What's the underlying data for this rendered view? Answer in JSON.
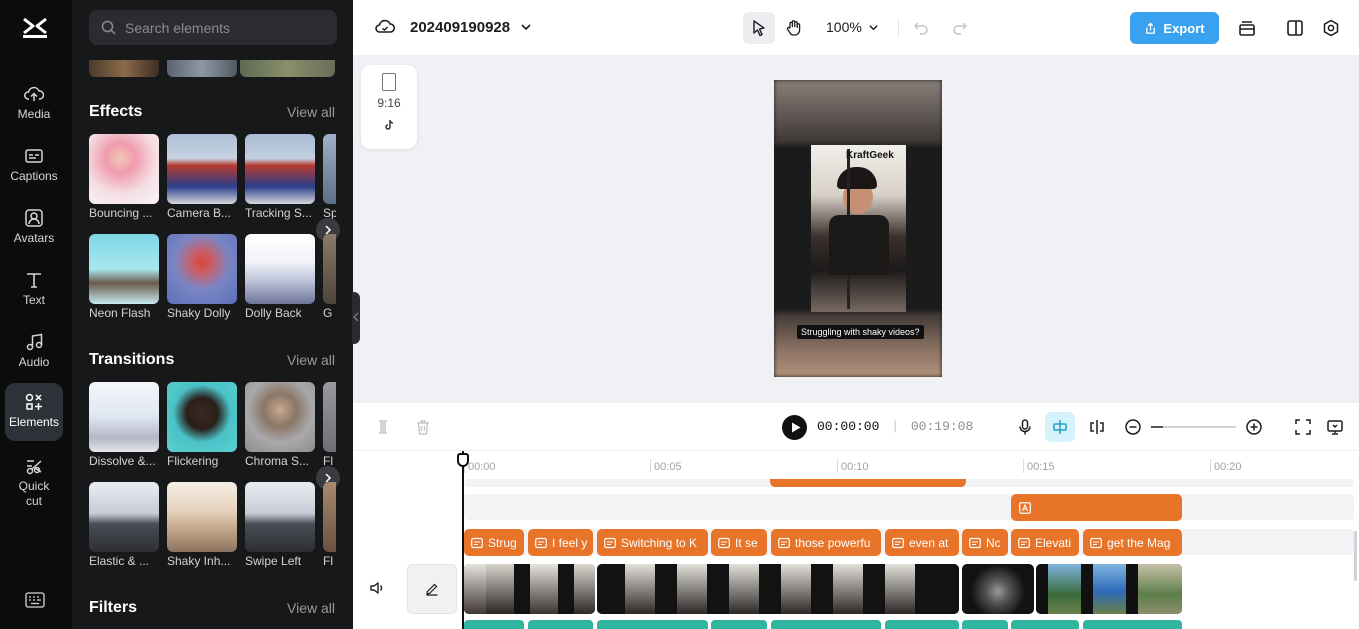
{
  "nav": {
    "items": [
      {
        "label": "Media",
        "icon": "cloud-upload-icon"
      },
      {
        "label": "Captions",
        "icon": "captions-icon"
      },
      {
        "label": "Avatars",
        "icon": "avatar-icon"
      },
      {
        "label": "Text",
        "icon": "text-icon"
      },
      {
        "label": "Audio",
        "icon": "music-note-icon"
      },
      {
        "label": "Elements",
        "icon": "elements-icon",
        "active": true
      },
      {
        "label": "Quick cut",
        "icon": "quick-cut-icon"
      }
    ]
  },
  "panel": {
    "search_placeholder": "Search elements",
    "effects": {
      "title": "Effects",
      "view_all": "View all",
      "row1": [
        "Bouncing ...",
        "Camera B...",
        "Tracking S...",
        "Sp"
      ],
      "row2": [
        "Neon Flash",
        "Shaky Dolly",
        "Dolly Back",
        "G"
      ]
    },
    "transitions": {
      "title": "Transitions",
      "view_all": "View all",
      "row1": [
        "Dissolve &...",
        "Flickering",
        "Chroma S...",
        "Fl"
      ],
      "row2": [
        "Elastic & ...",
        "Shaky Inh...",
        "Swipe Left",
        "Fl"
      ]
    },
    "filters": {
      "title": "Filters",
      "view_all": "View all"
    }
  },
  "topbar": {
    "project_name": "202409190928",
    "zoom": "100%",
    "export_label": "Export"
  },
  "preview": {
    "ratio_label": "9:16",
    "watermark": "KraftGeek",
    "caption": "Struggling with shaky videos?"
  },
  "playback": {
    "current_time": "00:00:00",
    "separator": "|",
    "duration": "00:19:08"
  },
  "timeline": {
    "ruler": [
      "00:00",
      "00:05",
      "00:10",
      "00:15",
      "00:20"
    ],
    "caption_clips": [
      "Strug",
      "I feel y",
      "Switching to K",
      "It se",
      "those powerfu",
      "even at",
      "Nc",
      "Elevati",
      "get the Mag"
    ]
  },
  "colors": {
    "accent": "#3aa0f0",
    "clip_orange": "#e8742a",
    "nav_bg": "#0c0c0d",
    "panel_bg": "#17181a"
  }
}
